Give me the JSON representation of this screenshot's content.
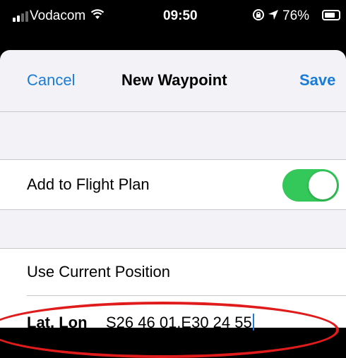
{
  "status_bar": {
    "carrier": "Vodacom",
    "time": "09:50",
    "battery": "76%",
    "battery_level": 0.76,
    "icons": [
      "signal-icon",
      "wifi-icon",
      "rotation-lock-icon",
      "location-icon",
      "battery-icon"
    ]
  },
  "nav": {
    "cancel_label": "Cancel",
    "title": "New Waypoint",
    "save_label": "Save"
  },
  "rows": {
    "flight_plan_label": "Add to Flight Plan",
    "flight_plan_enabled": true,
    "current_position_label": "Use Current Position",
    "latlon_label": "Lat, Lon",
    "latlon_value": "S26 46 01,E30 24 55"
  },
  "colors": {
    "accent": "#1a7bd8",
    "toggle_on": "#34c759",
    "highlight": "#e01b1b",
    "grouped_background": "#f2f2f7"
  }
}
